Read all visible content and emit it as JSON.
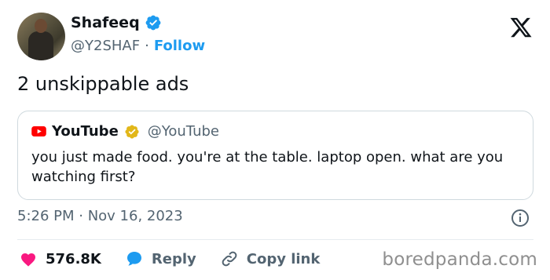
{
  "author": {
    "name": "Shafeeq",
    "handle": "@Y2SHAF",
    "separator": "·",
    "follow_label": "Follow"
  },
  "tweet": {
    "text": "2 unskippable ads",
    "timestamp": "5:26 PM · Nov 16, 2023"
  },
  "quoted": {
    "name": "YouTube",
    "handle": "@YouTube",
    "text": "you just made food. you're at the table. laptop open. what are you watching first?"
  },
  "actions": {
    "likes": "576.8K",
    "reply_label": "Reply",
    "copy_label": "Copy link"
  },
  "watermark": "boredpanda.com",
  "colors": {
    "accent": "#1d9bf0",
    "like": "#f91880",
    "youtube_red": "#ff0000",
    "gold_badge": "#e2b719"
  },
  "icons": {
    "verified": "blue-check-badge",
    "gold_verified": "gold-check-badge",
    "platform": "x-logo",
    "info": "info-circle",
    "like": "heart",
    "reply": "speech-bubble",
    "copy": "link-chain"
  }
}
